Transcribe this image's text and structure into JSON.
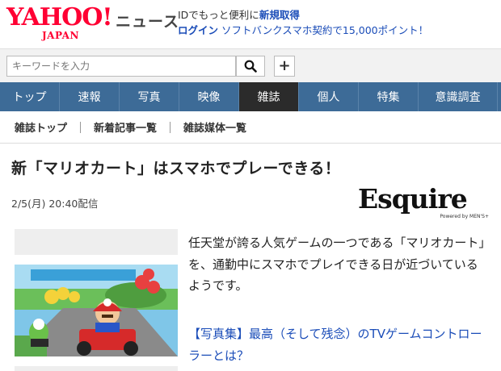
{
  "header": {
    "logo_text": "YAHOO!",
    "logo_sub": "JAPAN",
    "service_name": "ニュース",
    "promo_line1_prefix": "IDでもっと便利に",
    "promo_line1_link": "新規取得",
    "promo_line2_link": "ログイン",
    "promo_line2_text": "ソフトバンクスマホ契約で15,000ポイント！"
  },
  "search": {
    "placeholder": "キーワードを入力",
    "plus_label": "+"
  },
  "nav": {
    "items": [
      "トップ",
      "速報",
      "写真",
      "映像",
      "雑誌",
      "個人",
      "特集",
      "意識調査"
    ],
    "active": "雑誌"
  },
  "subnav": {
    "items": [
      "雑誌トップ",
      "新着記事一覧",
      "雑誌媒体一覧"
    ]
  },
  "article": {
    "headline": "新「マリオカート」はスマホでプレーできる！",
    "date": "2/5(月) 20:40配信",
    "publisher_logo": "Esquire",
    "publisher_sub": "Powered by MEN'S+",
    "body": "任天堂が誇る人気ゲームの一つである「マリオカート」を、通勤中にスマホでプレイできる日が近づいているようです。",
    "related_link": "【写真集】最高（そして残念）のTVゲームコントローラーとは？"
  },
  "colors": {
    "brand": "#ff0033",
    "nav_bg": "#3d6b97",
    "nav_active": "#2b2b2b",
    "link": "#1a4cb8"
  }
}
